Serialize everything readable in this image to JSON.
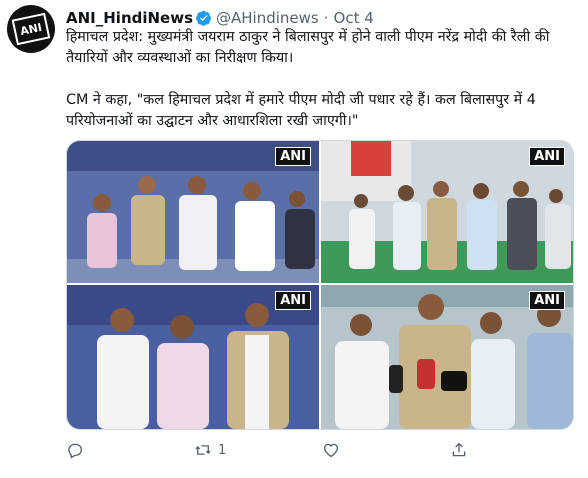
{
  "tweet": {
    "author_name": "ANI_HindiNews",
    "handle": "@AHindinews",
    "separator": "·",
    "date": "Oct 4",
    "avatar_text": "ANI",
    "text_line1": "हिमाचल प्रदेश: मुख्यमंत्री जयराम ठाकुर ने बिलासपुर में होने वाली पीएम नरेंद्र मोदी की रैली की तैयारियों और व्यवस्थाओं का निरीक्षण किया।",
    "text_line2": "CM ने कहा, \"कल हिमाचल प्रदेश में हमारे पीएम मोदी जी पधार रहे हैं। कल बिलासपुर में 4 परियोजनाओं का उद्घाटन और आधारशिला रखी जाएगी।\"",
    "photos": [
      {
        "watermark": "ANI"
      },
      {
        "watermark": "ANI"
      },
      {
        "watermark": "ANI"
      },
      {
        "watermark": "ANI"
      }
    ],
    "retweet_count": "1",
    "colors": {
      "verified": "#1d9bf0",
      "muted": "#536471",
      "text": "#0f1419"
    }
  }
}
